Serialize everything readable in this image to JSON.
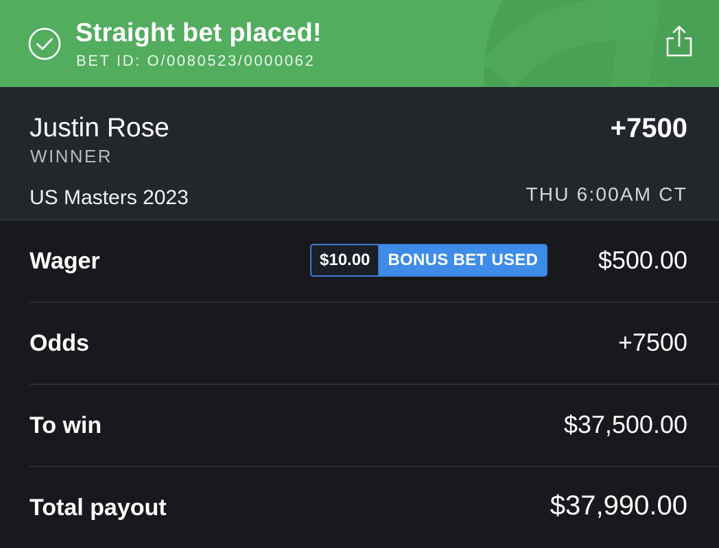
{
  "header": {
    "title": "Straight bet placed!",
    "bet_id": "BET ID: O/0080523/0000062",
    "icons": {
      "status": "check-circle-icon",
      "share": "share-icon"
    },
    "background_color": "#52ad5e"
  },
  "selection": {
    "name": "Justin Rose",
    "market": "WINNER",
    "odds": "+7500",
    "event": "US Masters 2023",
    "start_time": "THU 6:00AM CT"
  },
  "details": {
    "wager": {
      "label": "Wager",
      "bonus_amount": "$10.00",
      "bonus_label": "BONUS BET USED",
      "value": "$500.00"
    },
    "odds": {
      "label": "Odds",
      "value": "+7500"
    },
    "to_win": {
      "label": "To win",
      "value": "$37,500.00"
    },
    "total_payout": {
      "label": "Total payout",
      "value": "$37,990.00"
    }
  },
  "colors": {
    "accent_green": "#52ad5e",
    "bonus_blue": "#3f8ce8",
    "panel_bg": "#23272c",
    "page_bg": "#18191d"
  }
}
